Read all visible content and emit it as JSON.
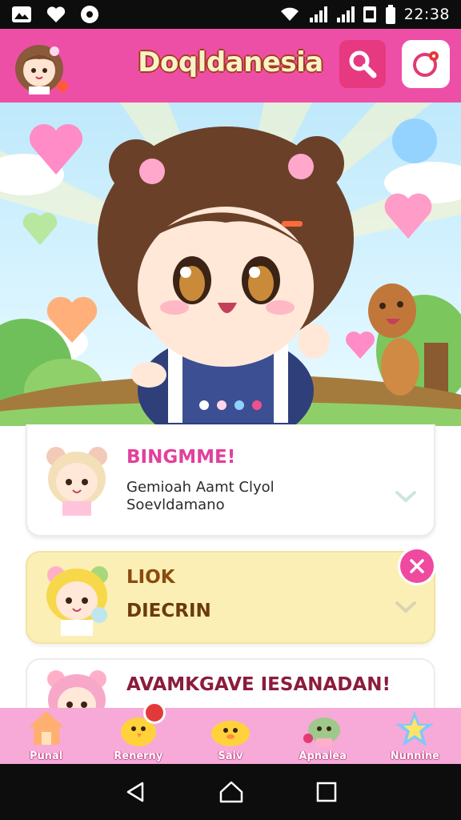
{
  "status_bar": {
    "time": "22:38",
    "left_icons": [
      "image-icon",
      "heart-icon",
      "settings-badge-icon"
    ],
    "right_icons": [
      "wifi-icon",
      "signal-icon",
      "signal-icon",
      "sim-icon",
      "battery-icon"
    ]
  },
  "app_bar": {
    "title": "Doqldanesia",
    "avatar_icon": "anime-girl-avatar-icon",
    "search_icon": "search-icon",
    "notification_icon": "notification-icon"
  },
  "hero": {
    "carousel_dots": 4,
    "active_dot": 3,
    "dot_colors": [
      "#ffffff",
      "#ffd6e8",
      "#8fd0ff",
      "#f0508e"
    ]
  },
  "cards": [
    {
      "title": "BINGMME!",
      "title_color": "#e0419c",
      "desc_line1": "Gemioah Aamt Clyol",
      "desc_line2": "Soevldamano",
      "action_icon": "chevron-down-icon"
    },
    {
      "title": "LIOK",
      "subtitle": "DIECRIN",
      "title_color": "#8a4b10",
      "action_icon": "chevron-down-icon",
      "close_icon": "close-icon"
    },
    {
      "title": "AVAMKGAVE IESANADAN!",
      "title_color": "#8b1c3c"
    }
  ],
  "bottom_nav": {
    "items": [
      {
        "label": "Punal",
        "icon": "home-icon"
      },
      {
        "label": "Renerny",
        "icon": "chick-icon"
      },
      {
        "label": "Saiv",
        "icon": "duck-icon"
      },
      {
        "label": "Apnalea",
        "icon": "creature-icon"
      },
      {
        "label": "Nunnine",
        "icon": "star-icon"
      }
    ]
  },
  "colors": {
    "primary": "#ee4fa6",
    "nav_bg": "#f7a9d8",
    "card_yellow": "#fbefb6"
  }
}
